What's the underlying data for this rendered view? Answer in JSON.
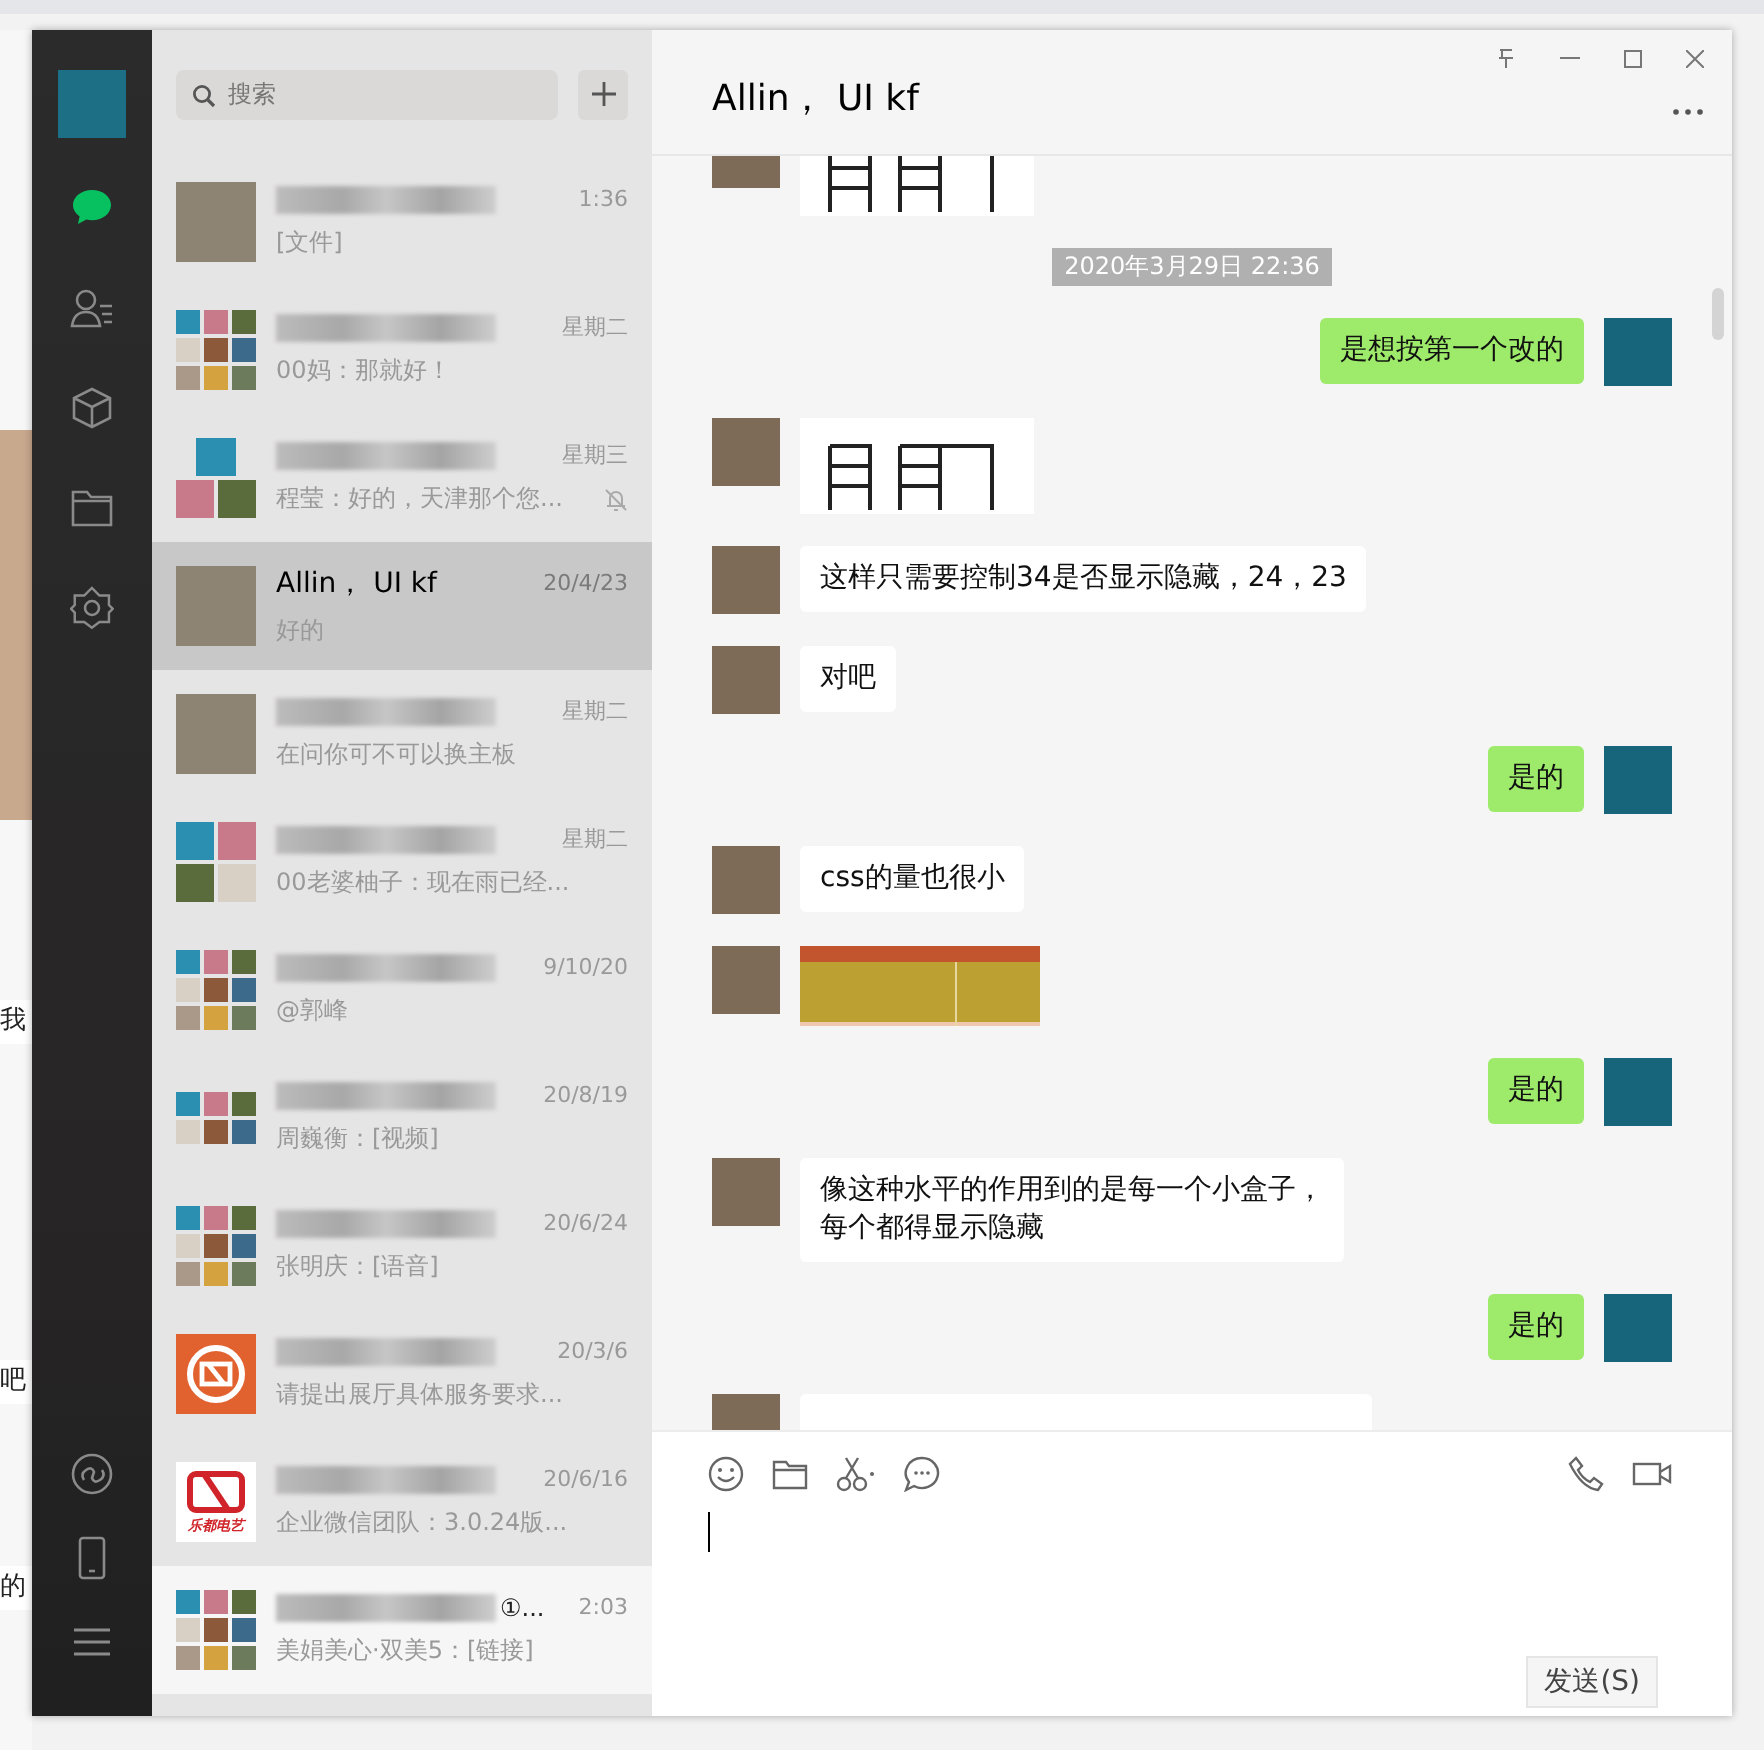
{
  "background_app": {
    "fragments": [
      "我",
      "吧",
      "的"
    ]
  },
  "sidebar": {
    "items": [
      {
        "kind": "chats",
        "selected": true
      },
      {
        "kind": "contacts",
        "selected": false
      },
      {
        "kind": "favorites",
        "selected": false
      },
      {
        "kind": "files",
        "selected": false
      },
      {
        "kind": "mini_programs",
        "selected": false
      }
    ],
    "bottom_items": [
      {
        "kind": "moments"
      },
      {
        "kind": "phone"
      },
      {
        "kind": "menu"
      }
    ]
  },
  "search": {
    "placeholder": "搜索"
  },
  "chats": [
    {
      "avatar": {
        "kind": "photo"
      },
      "blurred_name": true,
      "time": "1:36",
      "preview": "[文件]",
      "selected": false,
      "muted": false,
      "hovered": false
    },
    {
      "avatar": {
        "kind": "grid9"
      },
      "blurred_name": true,
      "time": "星期二",
      "preview": "00妈：那就好！",
      "selected": false,
      "muted": false,
      "hovered": false
    },
    {
      "avatar": {
        "kind": "grid3"
      },
      "blurred_name": true,
      "time": "星期三",
      "preview": "程莹：好的，天津那个您...",
      "selected": false,
      "muted": true,
      "hovered": false
    },
    {
      "avatar": {
        "kind": "photo"
      },
      "name": "Allin， UI kf",
      "time": "20/4/23",
      "preview": "好的",
      "selected": true,
      "muted": false,
      "hovered": false
    },
    {
      "avatar": {
        "kind": "photo"
      },
      "blurred_name": true,
      "time": "星期二",
      "preview": "在问你可不可以换主板",
      "selected": false,
      "muted": false,
      "hovered": false
    },
    {
      "avatar": {
        "kind": "grid4"
      },
      "blurred_name": true,
      "time": "星期二",
      "preview": "00老婆柚子：现在雨已经...",
      "selected": false,
      "muted": false,
      "hovered": false
    },
    {
      "avatar": {
        "kind": "grid9"
      },
      "blurred_name": true,
      "time": "9/10/20",
      "preview": "@郭峰",
      "selected": false,
      "muted": false,
      "hovered": false
    },
    {
      "avatar": {
        "kind": "grid6"
      },
      "blurred_name": true,
      "time": "20/8/19",
      "preview": "周巍衡：[视频]",
      "selected": false,
      "muted": false,
      "hovered": false
    },
    {
      "avatar": {
        "kind": "grid9"
      },
      "blurred_name": true,
      "time": "20/6/24",
      "preview": "张明庆：[语音]",
      "selected": false,
      "muted": false,
      "hovered": false
    },
    {
      "avatar": {
        "kind": "orange_logo"
      },
      "blurred_name": true,
      "time": "20/3/6",
      "preview": "请提出展厅具体服务要求...",
      "selected": false,
      "muted": false,
      "hovered": false
    },
    {
      "avatar": {
        "kind": "red_logo",
        "text": "乐都电艺"
      },
      "blurred_name": true,
      "time": "20/6/16",
      "preview": "企业微信团队：3.0.24版...",
      "selected": false,
      "muted": false,
      "hovered": false
    },
    {
      "avatar": {
        "kind": "grid9"
      },
      "blurred_name": true,
      "name_suffix": "①...",
      "time": "2:03",
      "preview": "美娟美心·双美5：[链接]",
      "selected": false,
      "muted": false,
      "hovered": true
    }
  ],
  "conversation": {
    "title": "Allin， UI kf",
    "messages": [
      {
        "kind": "sketch",
        "outgoing": false,
        "cut": true
      },
      {
        "kind": "time",
        "text": "2020年3月29日 22:36"
      },
      {
        "kind": "text",
        "outgoing": true,
        "lines": [
          "是想按第一个改的"
        ]
      },
      {
        "kind": "sketch",
        "outgoing": false
      },
      {
        "kind": "text",
        "outgoing": false,
        "lines": [
          "这样只需要控制34是否显示隐藏，24，23"
        ]
      },
      {
        "kind": "text",
        "outgoing": false,
        "lines": [
          "对吧"
        ]
      },
      {
        "kind": "text",
        "outgoing": true,
        "lines": [
          "是的"
        ]
      },
      {
        "kind": "text",
        "outgoing": false,
        "lines": [
          "css的量也很小"
        ]
      },
      {
        "kind": "color_image",
        "outgoing": false
      },
      {
        "kind": "text",
        "outgoing": true,
        "lines": [
          "是的"
        ]
      },
      {
        "kind": "text",
        "outgoing": false,
        "lines": [
          "像这种水平的作用到的是每一个小盒子，",
          "每个都得显示隐藏"
        ]
      },
      {
        "kind": "text",
        "outgoing": true,
        "lines": [
          "是的"
        ]
      },
      {
        "kind": "hidden_text",
        "outgoing": false
      }
    ]
  },
  "send_button": "发送(S)"
}
